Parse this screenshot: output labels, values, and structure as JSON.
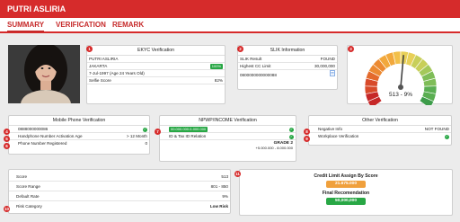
{
  "header": {
    "name": "PUTRI ASLIRIA"
  },
  "tabs": [
    {
      "label": "SUMMARY"
    },
    {
      "label": "VERIFICATION"
    },
    {
      "label": "REMARK"
    }
  ],
  "ekyc": {
    "number": "1",
    "title": "EKYC Verification",
    "name": "PUTRI ASLIRIA",
    "city": "JAKARTA",
    "city_match": "100%",
    "dob": "7-Jul-1997 (Age 24 Years Old)",
    "selfie_label": "Selfie Score",
    "selfie_value": "82%"
  },
  "slik": {
    "number": "2",
    "title": "SLIK Information",
    "result_label": "SLIK Result",
    "result_value": "FOUND",
    "limit_label": "Highest CC Limit",
    "limit_value": "30,000,000",
    "id_value": "0800000000000088"
  },
  "gauge": {
    "number": "3",
    "value_text": "513 - 9%",
    "fraction": 0.52
  },
  "mobile": {
    "title": "Mobile Phone Verification",
    "phone_number": "4",
    "phone": "0888000000086",
    "activation_number": "5",
    "activation_label": "Handphone Number Activation Age",
    "activation_value": "> 12 Month",
    "registered_number": "6",
    "registered_label": "Phone Number Registered",
    "registered_value": "0"
  },
  "npwp": {
    "title": "NPWP/INCOME Verification",
    "id_number": "7",
    "npwp_value": "00.000.000.0-000.000",
    "relation_label": "ID & Tax ID Relation",
    "grade": "GRADE 2",
    "grade_range": "+5.000.000 - 8.000.000"
  },
  "other": {
    "title": "Other Verification",
    "negative_number": "8",
    "negative_label": "Negative Info",
    "negative_value": "NOT FOUND",
    "workplace_number": "9",
    "workplace_label": "Workplace Verification"
  },
  "score": {
    "number": "10",
    "rows": [
      {
        "label": "Score",
        "value": "513"
      },
      {
        "label": "Score Range",
        "value": "801 - 850"
      },
      {
        "label": "Default Rate",
        "value": "9%"
      },
      {
        "label": "Risk Category",
        "value": "Low Risk"
      }
    ]
  },
  "credit": {
    "number": "11",
    "title": "Credit Limit Assign By Score",
    "limit_value": "21.675.000",
    "final_title": "Final Recomendation",
    "final_value": "50,000,000"
  },
  "colors": {
    "brand": "#d62b2b",
    "orange": "#f0a03c",
    "green": "#28a745"
  }
}
